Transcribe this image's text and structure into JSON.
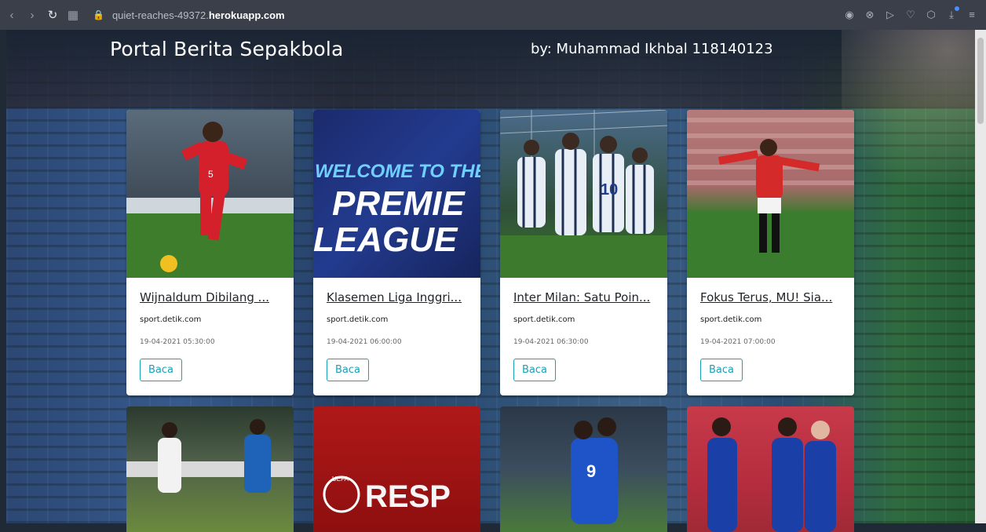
{
  "browser": {
    "url_sub": "quiet-reaches-49372.",
    "url_domain": "herokuapp.com",
    "back_icon": "chevron-left-icon",
    "forward_icon": "chevron-right-icon",
    "reload_icon": "reload-icon",
    "apps_icon": "grid-icon",
    "lock_icon": "lock-icon",
    "tools": [
      "camera-icon",
      "close-circle-icon",
      "send-icon",
      "heart-icon",
      "cube-icon",
      "download-icon",
      "menu-icon"
    ]
  },
  "header": {
    "title": "Portal Berita Sepakbola",
    "byline": "by: Muhammad Ikhbal 118140123"
  },
  "cards": [
    {
      "title": "Wijnaldum Dibilang ...",
      "source": "sport.detik.com",
      "date": "19-04-2021 05:30:00",
      "button": "Baca"
    },
    {
      "title": "Klasemen Liga Inggri...",
      "source": "sport.detik.com",
      "date": "19-04-2021 06:00:00",
      "button": "Baca"
    },
    {
      "title": "Inter Milan: Satu Poin...",
      "source": "sport.detik.com",
      "date": "19-04-2021 06:30:00",
      "button": "Baca"
    },
    {
      "title": "Fokus Terus, MU! Sia...",
      "source": "sport.detik.com",
      "date": "19-04-2021 07:00:00",
      "button": "Baca"
    }
  ],
  "image_text": {
    "welcome": "WELCOME TO THE",
    "premier": "PREMIE",
    "league": "LEAGUE",
    "respect": "RESP",
    "uefa": "UEFA",
    "kit_number_2": "5",
    "kit_number_3": "10",
    "kit_number_7": "9"
  },
  "colors": {
    "accent": "#17a2b8",
    "browser_bar": "#3a3f49"
  }
}
